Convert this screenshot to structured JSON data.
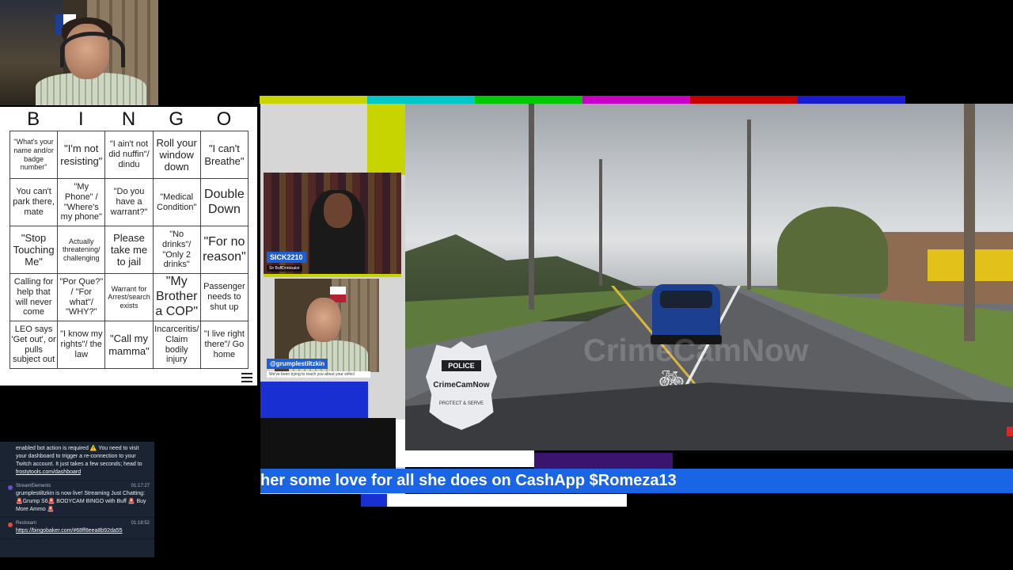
{
  "bingo": {
    "letters": [
      "B",
      "I",
      "N",
      "G",
      "O"
    ],
    "cells": [
      "\"What's your name and/or badge number\"",
      "\"I'm not resisting\"",
      "\"I ain't not did nuffin\"/ dindu",
      "Roll your window down",
      "\"I can't Breathe\"",
      "You can't park there, mate",
      "\"My Phone\" / \"Where's my phone\"",
      "\"Do you have a warrant?\"",
      "\"Medical Condition\"",
      "Double Down",
      "\"Stop Touching Me\"",
      "Actually threatening/ challenging",
      "Please take me to jail",
      "\"No drinks\"/ \"Only 2 drinks\"",
      "\"For no reason\"",
      "Calling for help that will never come",
      "\"Por Que?\" / \"For what\"/ \"WHY?\"",
      "Warrant for Arrest/search exists",
      "\"My Brother a COP\"",
      "Passenger needs to shut up",
      "LEO says 'Get out', or pulls subject out",
      "\"I know my rights\"/ the law",
      "\"Call my mamma\"",
      "Incarceritis/ Claim bodily injury",
      "\"I live right there\"/ Go home"
    ]
  },
  "chat": {
    "messages": [
      {
        "name": "",
        "time": "",
        "text": "enabled bot action is required ⚠️ You need to visit your dashboard to trigger a re-connection to your Twitch account. It just takes a few seconds; head to",
        "link": "frostytools.com/dashboard",
        "dot": "#1b2433"
      },
      {
        "name": "StreamElements",
        "time": "01:17:27",
        "text": "grumplestiltzkin is now live! Streaming Just Chatting: 🚨Grump S6🚨 BODYCAM BINGO with Buff 🚨 Buy More Ammo 🚨",
        "link": "",
        "dot": "#6d4cd6"
      },
      {
        "name": "Restream",
        "time": "01:18:52",
        "text": "",
        "link": "https://bingobaker.com/#68ff8eea8b92da55",
        "dot": "#e24b3a"
      }
    ]
  },
  "cams": {
    "sick_name": "SICK2210",
    "sick_sub": "Sir BuffDrinksalot",
    "grump_name": "@grumplestiltzkin",
    "grump_sub": "We've been trying to reach you about your vehicl"
  },
  "dashcam": {
    "badge_top": "POLICE",
    "badge_brand": "CrimeCamNow",
    "badge_motto": "PROTECT & SERVE",
    "watermark": "CrimeCamNow"
  },
  "ticker": {
    "text": "her some love for all she does on CashApp $Romeza13"
  },
  "colors": {
    "test_bars": [
      "#c8d400",
      "#00c8c8",
      "#00c800",
      "#c800c8",
      "#c80000",
      "#1a1ad1",
      "#000000"
    ]
  }
}
